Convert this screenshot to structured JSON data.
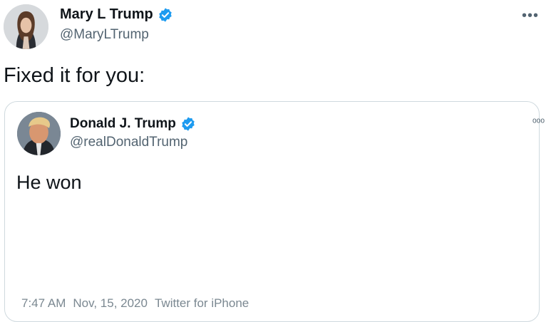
{
  "tweet": {
    "author_name": "Mary L Trump",
    "author_handle": "@MaryLTrump",
    "more_label": "•••",
    "text": "Fixed it for you:"
  },
  "quoted": {
    "author_name": "Donald J. Trump",
    "author_handle": "@realDonaldTrump",
    "more_label": "ᵒᵒᵒ",
    "text": "He won",
    "time": "7:47 AM",
    "date": "Nov, 15, 2020",
    "source": "Twitter for iPhone"
  },
  "colors": {
    "verified_badge": "#1d9bf0",
    "secondary_text": "#536471",
    "border": "#cfd9de"
  },
  "icons": {
    "verified": "verified-badge-icon",
    "more": "more-options-icon"
  }
}
